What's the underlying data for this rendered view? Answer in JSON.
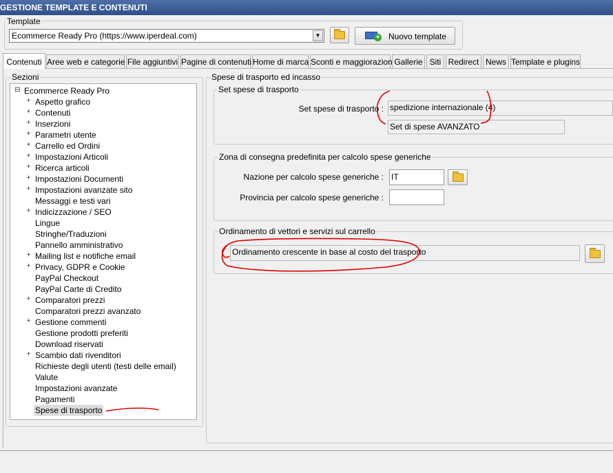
{
  "window": {
    "title": "GESTIONE TEMPLATE E CONTENUTI"
  },
  "template": {
    "group_label": "Template",
    "selected": "Ecommerce Ready Pro (https://www.iperdeal.com)",
    "new_template_label": "Nuovo template"
  },
  "tabs": [
    {
      "label": "Contenuti",
      "active": true
    },
    {
      "label": "Aree web e categorie"
    },
    {
      "label": "File aggiuntivi"
    },
    {
      "label": "Pagine di contenuti"
    },
    {
      "label": "Home di marca"
    },
    {
      "label": "Sconti e maggiorazioni"
    },
    {
      "label": "Gallerie"
    },
    {
      "label": "Siti"
    },
    {
      "label": "Redirect"
    },
    {
      "label": "News"
    },
    {
      "label": "Template e plugins"
    }
  ],
  "sections": {
    "group_label": "Sezioni",
    "root": "Ecommerce Ready Pro",
    "root_expander": "⊟",
    "expander": "+",
    "items": [
      {
        "label": "Aspetto grafico",
        "expandable": true
      },
      {
        "label": "Contenuti",
        "expandable": true
      },
      {
        "label": "Inserzioni",
        "expandable": true
      },
      {
        "label": "Parametri utente",
        "expandable": true
      },
      {
        "label": "Carrello ed Ordini",
        "expandable": true
      },
      {
        "label": "Impostazioni Articoli",
        "expandable": true
      },
      {
        "label": "Ricerca articoli",
        "expandable": true
      },
      {
        "label": "Impostazioni Documenti",
        "expandable": true
      },
      {
        "label": "Impostazioni avanzate sito",
        "expandable": true
      },
      {
        "label": "Messaggi e testi vari",
        "expandable": false
      },
      {
        "label": "Indicizzazione / SEO",
        "expandable": true
      },
      {
        "label": "Lingue",
        "expandable": false
      },
      {
        "label": "Stringhe/Traduzioni",
        "expandable": false
      },
      {
        "label": "Pannello amministrativo",
        "expandable": false
      },
      {
        "label": "Mailing list e notifiche email",
        "expandable": true
      },
      {
        "label": "Privacy, GDPR e Cookie",
        "expandable": true
      },
      {
        "label": "PayPal Checkout",
        "expandable": false
      },
      {
        "label": "PayPal Carte di Credito",
        "expandable": false
      },
      {
        "label": "Comparatori prezzi",
        "expandable": true
      },
      {
        "label": "Comparatori prezzi avanzato",
        "expandable": false
      },
      {
        "label": "Gestione commenti",
        "expandable": true
      },
      {
        "label": "Gestione prodotti preferiti",
        "expandable": false
      },
      {
        "label": "Download riservati",
        "expandable": false
      },
      {
        "label": "Scambio dati rivenditori",
        "expandable": true
      },
      {
        "label": "Richieste degli utenti (testi delle email)",
        "expandable": false
      },
      {
        "label": "Valute",
        "expandable": false
      },
      {
        "label": "Impostazioni avanzate",
        "expandable": false
      },
      {
        "label": "Pagamenti",
        "expandable": false
      },
      {
        "label": "Spese di trasporto",
        "expandable": false,
        "selected": true
      }
    ]
  },
  "panel": {
    "title": "Spese di trasporto ed incasso",
    "set_group": {
      "label": "Set spese di trasporto",
      "field_label": "Set spese di trasporto :",
      "value": "spedizione internazionale (4)",
      "description": "Set di spese AVANZATO"
    },
    "zone_group": {
      "label": "Zona di consegna predefinita per calcolo spese generiche",
      "nation_label": "Nazione per calcolo spese generiche :",
      "nation_value": "IT",
      "province_label": "Provincia per calcolo spese generiche :",
      "province_value": ""
    },
    "order_group": {
      "label": "Ordinamento di vettori e servizi sul carrello",
      "value": "Ordinamento crescente in base al costo del trasporto"
    }
  },
  "colors": {
    "titlebar": "#3a5a95",
    "annotation": "#e00000",
    "selection": "#dcdcdc"
  }
}
